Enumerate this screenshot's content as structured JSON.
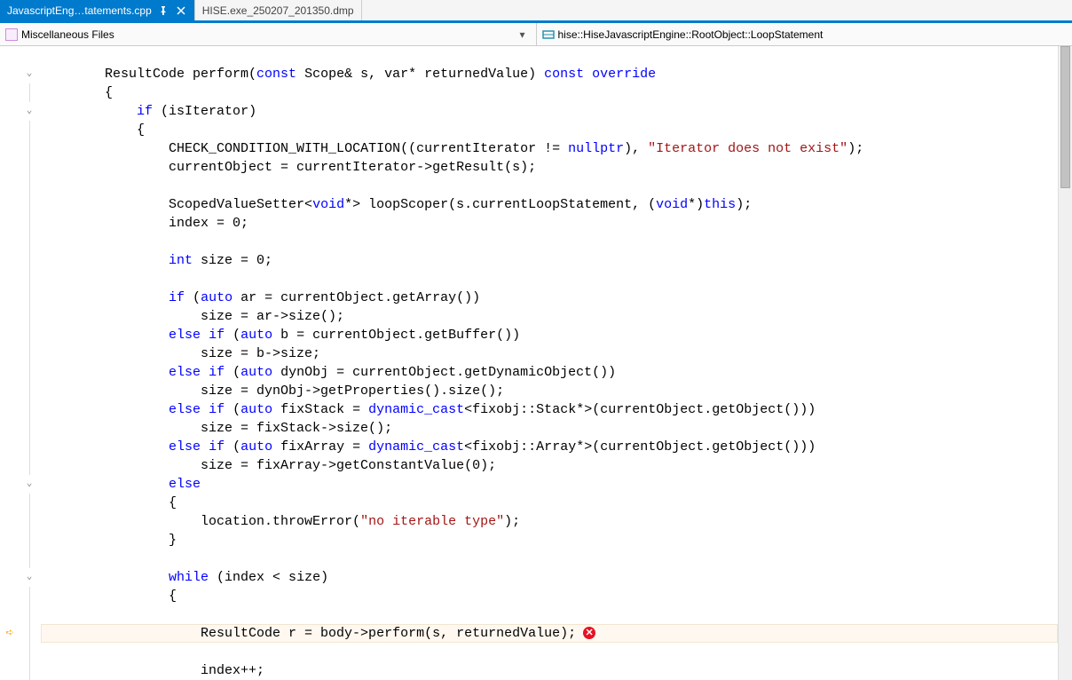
{
  "tabs": {
    "active": {
      "label": "JavascriptEng…tatements.cpp"
    },
    "inactive": {
      "label": "HISE.exe_250207_201350.dmp"
    }
  },
  "context": {
    "left": "Miscellaneous Files",
    "right": "hise::HiseJavascriptEngine::RootObject::LoopStatement"
  },
  "code": {
    "lines": [
      {
        "fold": "",
        "indent": 0,
        "tokens": []
      },
      {
        "fold": "chev",
        "indent": 2,
        "tokens": [
          [
            "nm",
            "ResultCode perform("
          ],
          [
            "kw",
            "const"
          ],
          [
            "nm",
            " Scope& s, var* returnedValue) "
          ],
          [
            "kw",
            "const"
          ],
          [
            "nm",
            " "
          ],
          [
            "kw",
            "override"
          ]
        ]
      },
      {
        "fold": "line",
        "indent": 2,
        "tokens": [
          [
            "nm",
            "{"
          ]
        ]
      },
      {
        "fold": "chev",
        "indent": 3,
        "tokens": [
          [
            "kw",
            "if"
          ],
          [
            "nm",
            " (isIterator)"
          ]
        ]
      },
      {
        "fold": "line",
        "indent": 3,
        "tokens": [
          [
            "nm",
            "{"
          ]
        ]
      },
      {
        "fold": "line",
        "indent": 4,
        "tokens": [
          [
            "nm",
            "CHECK_CONDITION_WITH_LOCATION((currentIterator != "
          ],
          [
            "kw",
            "nullptr"
          ],
          [
            "nm",
            "), "
          ],
          [
            "st",
            "\"Iterator does not exist\""
          ],
          [
            "nm",
            ");"
          ]
        ]
      },
      {
        "fold": "line",
        "indent": 4,
        "tokens": [
          [
            "nm",
            "currentObject = currentIterator->getResult(s);"
          ]
        ]
      },
      {
        "fold": "line",
        "indent": 0,
        "tokens": []
      },
      {
        "fold": "line",
        "indent": 4,
        "tokens": [
          [
            "nm",
            "ScopedValueSetter<"
          ],
          [
            "kw",
            "void"
          ],
          [
            "nm",
            "*> loopScoper(s.currentLoopStatement, ("
          ],
          [
            "kw",
            "void"
          ],
          [
            "nm",
            "*)"
          ],
          [
            "kw",
            "this"
          ],
          [
            "nm",
            ");"
          ]
        ]
      },
      {
        "fold": "line",
        "indent": 4,
        "tokens": [
          [
            "nm",
            "index = 0;"
          ]
        ]
      },
      {
        "fold": "line",
        "indent": 0,
        "tokens": []
      },
      {
        "fold": "line",
        "indent": 4,
        "tokens": [
          [
            "kw",
            "int"
          ],
          [
            "nm",
            " size = 0;"
          ]
        ]
      },
      {
        "fold": "line",
        "indent": 0,
        "tokens": []
      },
      {
        "fold": "line",
        "indent": 4,
        "tokens": [
          [
            "kw",
            "if"
          ],
          [
            "nm",
            " ("
          ],
          [
            "kw",
            "auto"
          ],
          [
            "nm",
            " ar = currentObject.getArray())"
          ]
        ]
      },
      {
        "fold": "line",
        "indent": 5,
        "tokens": [
          [
            "nm",
            "size = ar->size();"
          ]
        ]
      },
      {
        "fold": "line",
        "indent": 4,
        "tokens": [
          [
            "kw",
            "else"
          ],
          [
            "nm",
            " "
          ],
          [
            "kw",
            "if"
          ],
          [
            "nm",
            " ("
          ],
          [
            "kw",
            "auto"
          ],
          [
            "nm",
            " b = currentObject.getBuffer())"
          ]
        ]
      },
      {
        "fold": "line",
        "indent": 5,
        "tokens": [
          [
            "nm",
            "size = b->size;"
          ]
        ]
      },
      {
        "fold": "line",
        "indent": 4,
        "tokens": [
          [
            "kw",
            "else"
          ],
          [
            "nm",
            " "
          ],
          [
            "kw",
            "if"
          ],
          [
            "nm",
            " ("
          ],
          [
            "kw",
            "auto"
          ],
          [
            "nm",
            " dynObj = currentObject.getDynamicObject())"
          ]
        ]
      },
      {
        "fold": "line",
        "indent": 5,
        "tokens": [
          [
            "nm",
            "size = dynObj->getProperties().size();"
          ]
        ]
      },
      {
        "fold": "line",
        "indent": 4,
        "tokens": [
          [
            "kw",
            "else"
          ],
          [
            "nm",
            " "
          ],
          [
            "kw",
            "if"
          ],
          [
            "nm",
            " ("
          ],
          [
            "kw",
            "auto"
          ],
          [
            "nm",
            " fixStack = "
          ],
          [
            "kw",
            "dynamic_cast"
          ],
          [
            "nm",
            "<fixobj::Stack*>(currentObject.getObject()))"
          ]
        ]
      },
      {
        "fold": "line",
        "indent": 5,
        "tokens": [
          [
            "nm",
            "size = fixStack->size();"
          ]
        ]
      },
      {
        "fold": "line",
        "indent": 4,
        "tokens": [
          [
            "kw",
            "else"
          ],
          [
            "nm",
            " "
          ],
          [
            "kw",
            "if"
          ],
          [
            "nm",
            " ("
          ],
          [
            "kw",
            "auto"
          ],
          [
            "nm",
            " fixArray = "
          ],
          [
            "kw",
            "dynamic_cast"
          ],
          [
            "nm",
            "<fixobj::Array*>(currentObject.getObject()))"
          ]
        ]
      },
      {
        "fold": "line",
        "indent": 5,
        "tokens": [
          [
            "nm",
            "size = fixArray->getConstantValue(0);"
          ]
        ]
      },
      {
        "fold": "chev",
        "indent": 4,
        "tokens": [
          [
            "kw",
            "else"
          ]
        ]
      },
      {
        "fold": "line",
        "indent": 4,
        "tokens": [
          [
            "nm",
            "{"
          ]
        ]
      },
      {
        "fold": "line",
        "indent": 5,
        "tokens": [
          [
            "nm",
            "location.throwError("
          ],
          [
            "st",
            "\"no iterable type\""
          ],
          [
            "nm",
            ");"
          ]
        ]
      },
      {
        "fold": "line",
        "indent": 4,
        "tokens": [
          [
            "nm",
            "}"
          ]
        ]
      },
      {
        "fold": "line",
        "indent": 0,
        "tokens": []
      },
      {
        "fold": "chev",
        "indent": 4,
        "tokens": [
          [
            "kw",
            "while"
          ],
          [
            "nm",
            " (index < size)"
          ]
        ]
      },
      {
        "fold": "line",
        "indent": 4,
        "tokens": [
          [
            "nm",
            "{"
          ]
        ]
      },
      {
        "fold": "line",
        "indent": 0,
        "tokens": []
      },
      {
        "fold": "line",
        "indent": 5,
        "glyph": "arrow",
        "current": true,
        "error": true,
        "tokens": [
          [
            "nm",
            "ResultCode r = body->perform(s, returnedValue);"
          ]
        ]
      },
      {
        "fold": "line",
        "indent": 0,
        "tokens": []
      },
      {
        "fold": "line",
        "indent": 5,
        "tokens": [
          [
            "nm",
            "index++;"
          ]
        ]
      }
    ]
  }
}
